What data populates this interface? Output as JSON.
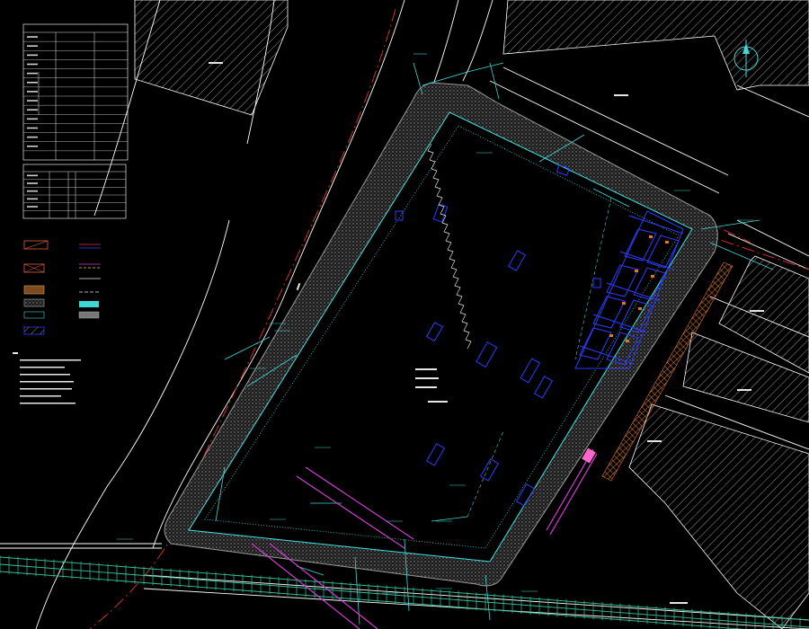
{
  "drawing": {
    "background": "#000000",
    "colors": {
      "building_hatch": "#ffffff",
      "road_line": "#ffffff",
      "center_line_red": "#e03030",
      "boundary_cyan": "#3fd6d6",
      "parking_blue": "#2d3cff",
      "magenta": "#d43cd4",
      "paving_gray": "#8a8a8a",
      "orange_strip": "#e0782a",
      "pink_strip": "#ff66cc",
      "rail_green": "#35c4a0"
    },
    "north_arrow_icon": "north-arrow-icon"
  },
  "table1": {
    "title": "",
    "header": [
      "",
      "",
      ""
    ],
    "row_count": 14
  },
  "table2": {
    "title": "",
    "row_count": 6
  },
  "legend": {
    "item_count": 14
  },
  "notes": {
    "line_count": 6
  },
  "site_notes": {
    "line_count": 4
  }
}
